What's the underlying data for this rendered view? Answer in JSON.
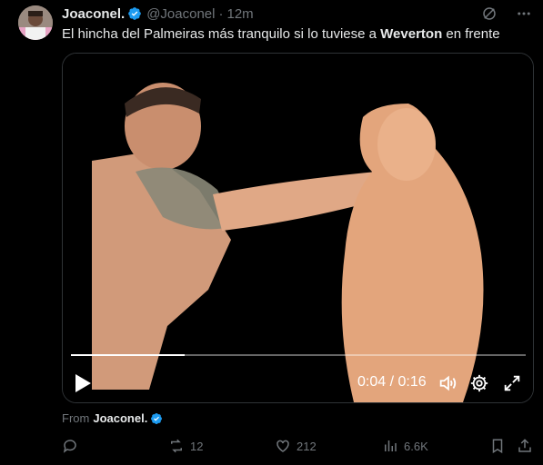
{
  "tweet": {
    "author_name": "Joaconel.",
    "handle": "@Joaconel",
    "separator": "·",
    "time": "12m",
    "text_before": "El hincha del Palmeiras más tranquilo si lo tuviese a ",
    "text_bold": "Weverton",
    "text_after": " en frente"
  },
  "video": {
    "time_display": "0:04 / 0:16",
    "progress": 0.25
  },
  "source": {
    "prefix": "From",
    "name": "Joaconel."
  },
  "actions": {
    "replies": "",
    "reposts": "12",
    "likes": "212",
    "views": "6.6K"
  },
  "colors": {
    "background": "#000000",
    "text": "#e7e9ea",
    "muted": "#71767b",
    "verified": "#1d9bf0"
  },
  "icons": [
    "verified-badge-icon",
    "grok-icon",
    "more-icon",
    "play-icon",
    "volume-icon",
    "settings-gear-icon",
    "fullscreen-icon",
    "reply-icon",
    "repost-icon",
    "like-icon",
    "views-icon",
    "bookmark-icon",
    "share-icon"
  ]
}
